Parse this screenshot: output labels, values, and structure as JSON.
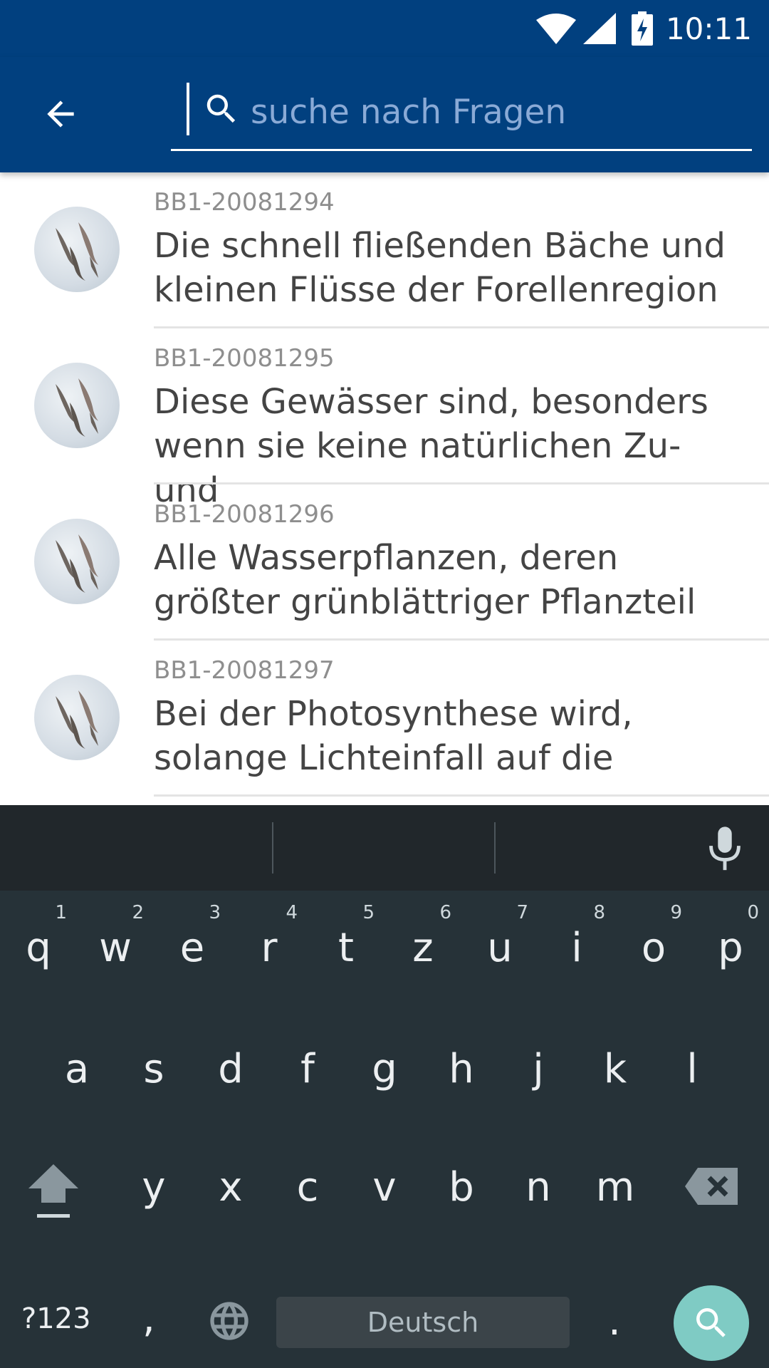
{
  "status_bar": {
    "time": "10:11",
    "icons": [
      "wifi-icon",
      "cell-signal-icon",
      "battery-charging-icon"
    ]
  },
  "toolbar": {
    "back_icon": "arrow-back-icon",
    "search": {
      "icon": "search-icon",
      "value": "",
      "placeholder": "suche nach Fragen"
    }
  },
  "results": [
    {
      "id": "BB1-20081294",
      "text_line1": "Die schnell fließenden Bäche und",
      "text_line2": "kleinen Flüsse der Forellenregion",
      "avatar": "fish-avatar"
    },
    {
      "id": "BB1-20081295",
      "text_line1": "Diese Gewässer sind, besonders",
      "text_line2": "wenn sie keine natürlichen Zu- und",
      "avatar": "fish-avatar"
    },
    {
      "id": "BB1-20081296",
      "text_line1": "Alle Wasserpflanzen, deren",
      "text_line2": "größter grünblättriger Pflanzteil",
      "avatar": "fish-avatar"
    },
    {
      "id": "BB1-20081297",
      "text_line1": "Bei der Photosynthese wird,",
      "text_line2": "solange Lichteinfall auf die",
      "avatar": "fish-avatar"
    }
  ],
  "keyboard": {
    "row1": [
      {
        "key": "q",
        "hint": "1"
      },
      {
        "key": "w",
        "hint": "2"
      },
      {
        "key": "e",
        "hint": "3"
      },
      {
        "key": "r",
        "hint": "4"
      },
      {
        "key": "t",
        "hint": "5"
      },
      {
        "key": "z",
        "hint": "6"
      },
      {
        "key": "u",
        "hint": "7"
      },
      {
        "key": "i",
        "hint": "8"
      },
      {
        "key": "o",
        "hint": "9"
      },
      {
        "key": "p",
        "hint": "0"
      }
    ],
    "row2": [
      "a",
      "s",
      "d",
      "f",
      "g",
      "h",
      "j",
      "k",
      "l"
    ],
    "row3": [
      "y",
      "x",
      "c",
      "v",
      "b",
      "n",
      "m"
    ],
    "symbols_label": "?123",
    "comma_label": ",",
    "period_label": ".",
    "space_label": "Deutsch",
    "action_icon": "search-icon",
    "shift_icon": "shift-icon",
    "delete_icon": "backspace-icon",
    "globe_icon": "globe-icon",
    "mic_icon": "mic-icon"
  },
  "colors": {
    "app_bar": "#01407f",
    "keyboard_bg": "#263238",
    "action_key": "#7fcbc4"
  }
}
